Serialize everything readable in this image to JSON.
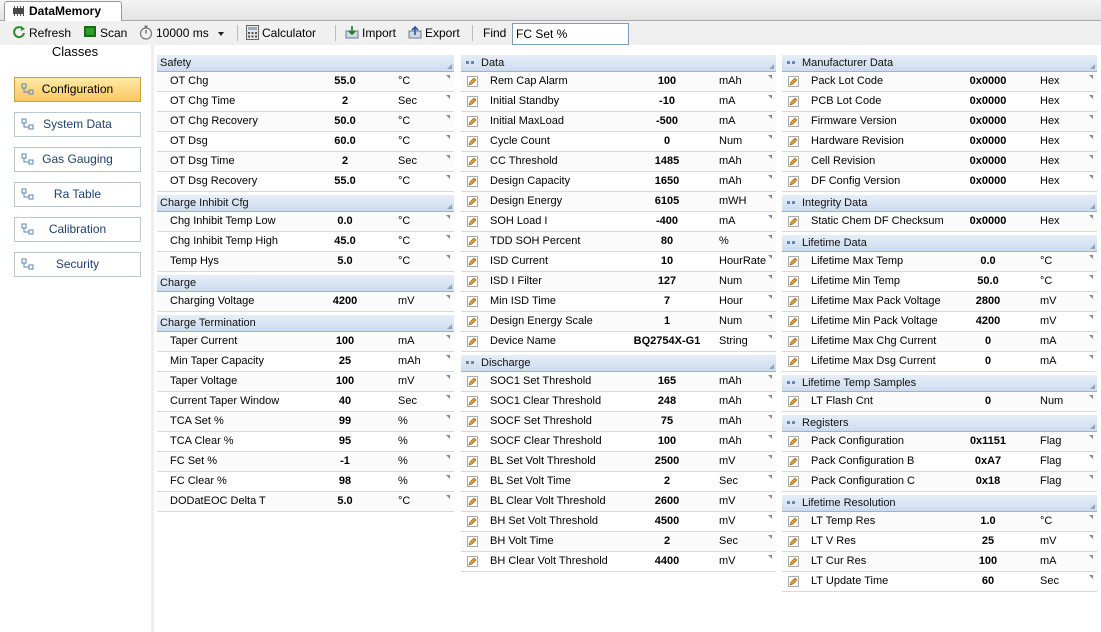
{
  "tab": {
    "label": "DataMemory"
  },
  "toolbar": {
    "refresh": "Refresh",
    "scan": "Scan",
    "interval": "10000 ms",
    "calculator": "Calculator",
    "import": "Import",
    "export": "Export",
    "find_label": "Find",
    "find_value": "FC Set %"
  },
  "classes": {
    "title": "Classes",
    "items": [
      "Configuration",
      "System Data",
      "Gas Gauging",
      "Ra Table",
      "Calibration",
      "Security"
    ]
  },
  "col1": [
    {
      "title": "Safety",
      "rows": [
        {
          "name": "OT Chg",
          "value": "55.0",
          "unit": "°C"
        },
        {
          "name": "OT Chg Time",
          "value": "2",
          "unit": "Sec"
        },
        {
          "name": "OT Chg Recovery",
          "value": "50.0",
          "unit": "°C"
        },
        {
          "name": "OT Dsg",
          "value": "60.0",
          "unit": "°C"
        },
        {
          "name": "OT Dsg Time",
          "value": "2",
          "unit": "Sec"
        },
        {
          "name": "OT Dsg Recovery",
          "value": "55.0",
          "unit": "°C"
        }
      ]
    },
    {
      "title": "Charge Inhibit Cfg",
      "rows": [
        {
          "name": "Chg Inhibit Temp Low",
          "value": "0.0",
          "unit": "°C"
        },
        {
          "name": "Chg Inhibit Temp High",
          "value": "45.0",
          "unit": "°C"
        },
        {
          "name": "Temp Hys",
          "value": "5.0",
          "unit": "°C"
        }
      ]
    },
    {
      "title": "Charge",
      "rows": [
        {
          "name": "Charging Voltage",
          "value": "4200",
          "unit": "mV"
        }
      ]
    },
    {
      "title": "Charge Termination",
      "rows": [
        {
          "name": "Taper Current",
          "value": "100",
          "unit": "mA"
        },
        {
          "name": "Min Taper Capacity",
          "value": "25",
          "unit": "mAh"
        },
        {
          "name": "Taper Voltage",
          "value": "100",
          "unit": "mV"
        },
        {
          "name": "Current Taper Window",
          "value": "40",
          "unit": "Sec"
        },
        {
          "name": "TCA Set %",
          "value": "99",
          "unit": "%"
        },
        {
          "name": "TCA Clear %",
          "value": "95",
          "unit": "%"
        },
        {
          "name": "FC Set %",
          "value": "-1",
          "unit": "%"
        },
        {
          "name": "FC Clear %",
          "value": "98",
          "unit": "%"
        },
        {
          "name": "DODatEOC Delta T",
          "value": "5.0",
          "unit": "°C"
        }
      ]
    }
  ],
  "col2": [
    {
      "title": "Data",
      "rows": [
        {
          "name": "Rem Cap Alarm",
          "value": "100",
          "unit": "mAh"
        },
        {
          "name": "Initial Standby",
          "value": "-10",
          "unit": "mA"
        },
        {
          "name": "Initial MaxLoad",
          "value": "-500",
          "unit": "mA"
        },
        {
          "name": "Cycle Count",
          "value": "0",
          "unit": "Num"
        },
        {
          "name": "CC Threshold",
          "value": "1485",
          "unit": "mAh"
        },
        {
          "name": "Design Capacity",
          "value": "1650",
          "unit": "mAh"
        },
        {
          "name": "Design Energy",
          "value": "6105",
          "unit": "mWH"
        },
        {
          "name": "SOH Load I",
          "value": "-400",
          "unit": "mA"
        },
        {
          "name": "TDD SOH Percent",
          "value": "80",
          "unit": "%"
        },
        {
          "name": "ISD Current",
          "value": "10",
          "unit": "HourRate"
        },
        {
          "name": "ISD I Filter",
          "value": "127",
          "unit": "Num"
        },
        {
          "name": "Min ISD Time",
          "value": "7",
          "unit": "Hour"
        },
        {
          "name": "Design Energy Scale",
          "value": "1",
          "unit": "Num"
        },
        {
          "name": "Device Name",
          "value": "BQ2754X-G1",
          "unit": "String"
        }
      ]
    },
    {
      "title": "Discharge",
      "rows": [
        {
          "name": "SOC1 Set Threshold",
          "value": "165",
          "unit": "mAh"
        },
        {
          "name": "SOC1 Clear Threshold",
          "value": "248",
          "unit": "mAh"
        },
        {
          "name": "SOCF Set Threshold",
          "value": "75",
          "unit": "mAh"
        },
        {
          "name": "SOCF Clear Threshold",
          "value": "100",
          "unit": "mAh"
        },
        {
          "name": "BL Set Volt Threshold",
          "value": "2500",
          "unit": "mV"
        },
        {
          "name": "BL Set Volt Time",
          "value": "2",
          "unit": "Sec"
        },
        {
          "name": "BL Clear Volt Threshold",
          "value": "2600",
          "unit": "mV"
        },
        {
          "name": "BH Set Volt Threshold",
          "value": "4500",
          "unit": "mV"
        },
        {
          "name": "BH Volt Time",
          "value": "2",
          "unit": "Sec"
        },
        {
          "name": "BH Clear Volt Threshold",
          "value": "4400",
          "unit": "mV"
        }
      ]
    }
  ],
  "col3": [
    {
      "title": "Manufacturer Data",
      "rows": [
        {
          "name": "Pack Lot Code",
          "value": "0x0000",
          "unit": "Hex"
        },
        {
          "name": "PCB Lot Code",
          "value": "0x0000",
          "unit": "Hex"
        },
        {
          "name": "Firmware Version",
          "value": "0x0000",
          "unit": "Hex"
        },
        {
          "name": "Hardware Revision",
          "value": "0x0000",
          "unit": "Hex"
        },
        {
          "name": "Cell Revision",
          "value": "0x0000",
          "unit": "Hex"
        },
        {
          "name": "DF Config Version",
          "value": "0x0000",
          "unit": "Hex"
        }
      ]
    },
    {
      "title": "Integrity Data",
      "rows": [
        {
          "name": "Static Chem DF Checksum",
          "value": "0x0000",
          "unit": "Hex"
        }
      ]
    },
    {
      "title": "Lifetime Data",
      "rows": [
        {
          "name": "Lifetime Max Temp",
          "value": "0.0",
          "unit": "°C"
        },
        {
          "name": "Lifetime Min Temp",
          "value": "50.0",
          "unit": "°C"
        },
        {
          "name": "Lifetime Max Pack Voltage",
          "value": "2800",
          "unit": "mV"
        },
        {
          "name": "Lifetime Min Pack Voltage",
          "value": "4200",
          "unit": "mV"
        },
        {
          "name": "Lifetime Max Chg Current",
          "value": "0",
          "unit": "mA"
        },
        {
          "name": "Lifetime Max Dsg Current",
          "value": "0",
          "unit": "mA"
        }
      ]
    },
    {
      "title": "Lifetime Temp Samples",
      "rows": [
        {
          "name": "LT Flash Cnt",
          "value": "0",
          "unit": "Num"
        }
      ]
    },
    {
      "title": "Registers",
      "rows": [
        {
          "name": "Pack Configuration",
          "value": "0x1151",
          "unit": "Flag"
        },
        {
          "name": "Pack Configuration B",
          "value": "0xA7",
          "unit": "Flag"
        },
        {
          "name": "Pack Configuration C",
          "value": "0x18",
          "unit": "Flag"
        }
      ]
    },
    {
      "title": "Lifetime Resolution",
      "rows": [
        {
          "name": "LT Temp Res",
          "value": "1.0",
          "unit": "°C"
        },
        {
          "name": "LT V Res",
          "value": "25",
          "unit": "mV"
        },
        {
          "name": "LT Cur Res",
          "value": "100",
          "unit": "mA"
        },
        {
          "name": "LT Update Time",
          "value": "60",
          "unit": "Sec"
        }
      ]
    }
  ]
}
